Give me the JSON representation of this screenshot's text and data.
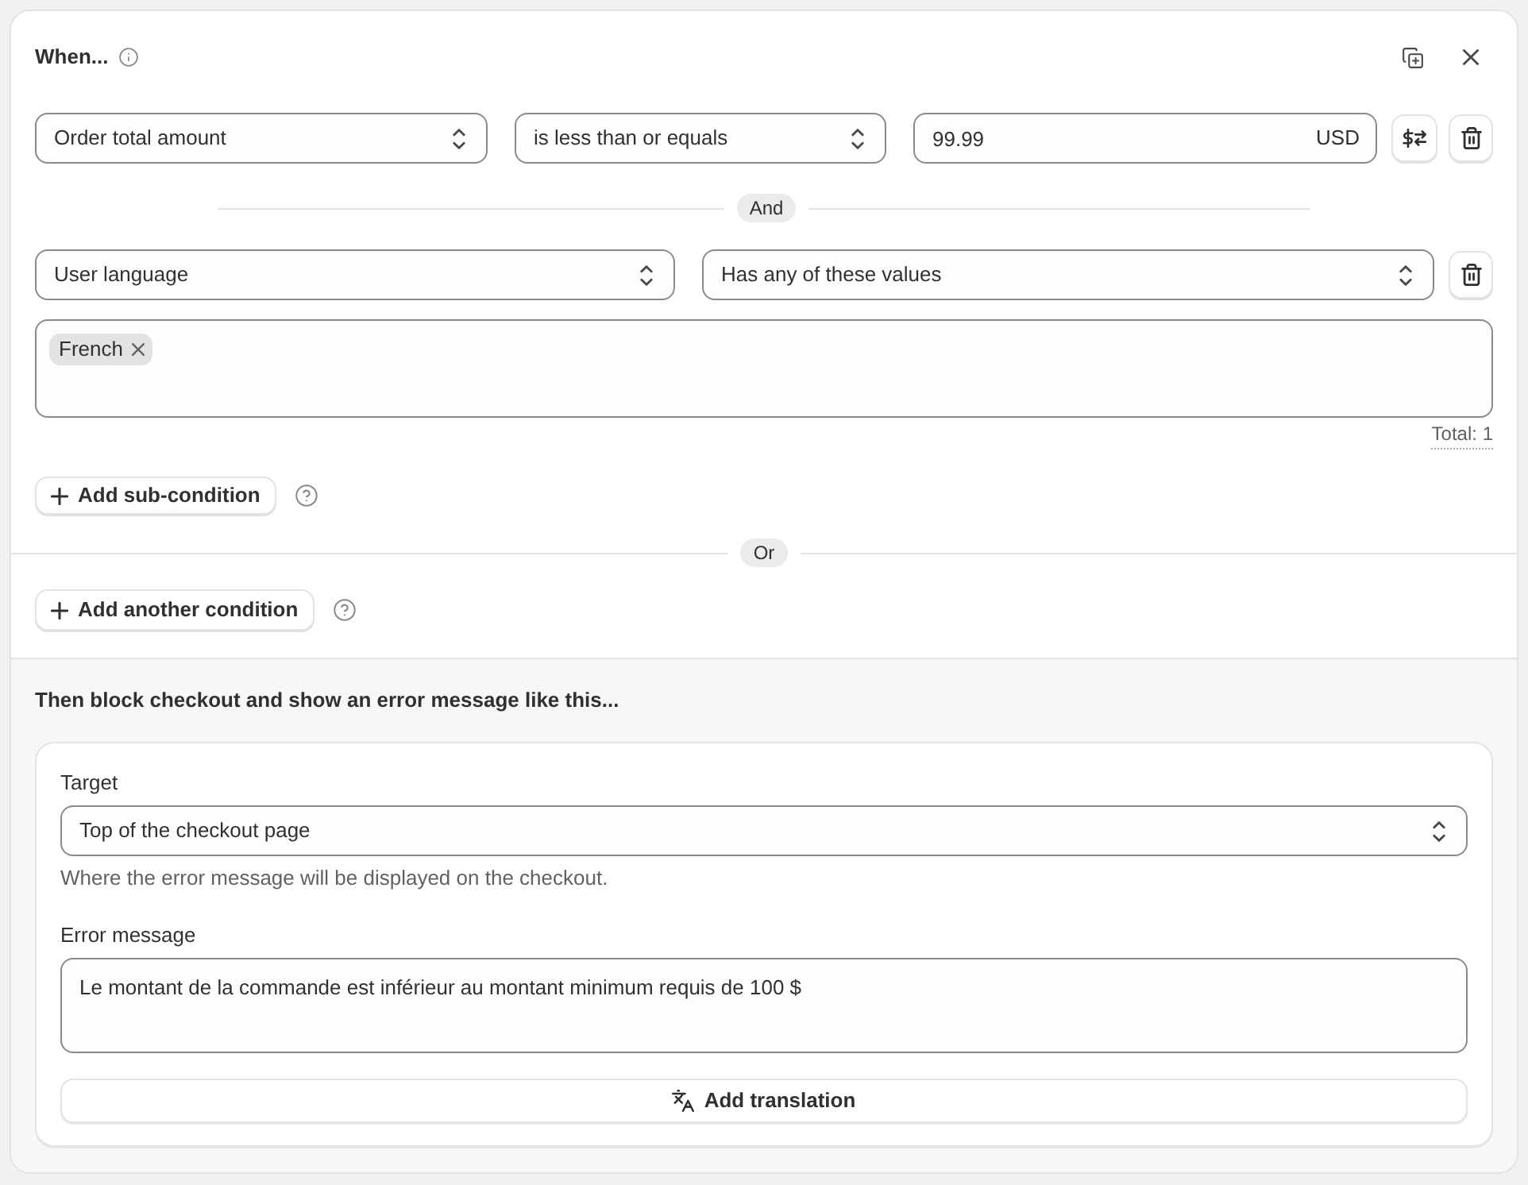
{
  "condition_group": {
    "title": "When...",
    "rules": [
      {
        "kind": "amount",
        "field": "Order total amount",
        "operator": "is less than or equals",
        "value": "99.99",
        "currency": "USD"
      },
      {
        "kind": "tags",
        "connector": "And",
        "field": "User language",
        "operator": "Has any of these values",
        "tags": [
          "French"
        ],
        "total": "Total: 1"
      }
    ],
    "add_sub_condition": "Add sub-condition"
  },
  "group_connector": "Or",
  "add_condition": "Add another condition",
  "action": {
    "title": "Then block checkout and show an error message like this...",
    "target": {
      "label": "Target",
      "value": "Top of the checkout page",
      "help": "Where the error message will be displayed on the checkout."
    },
    "error_message": {
      "label": "Error message",
      "value": "Le montant de la commande est inférieur au montant minimum requis de 100 $"
    },
    "add_translation": "Add translation"
  }
}
